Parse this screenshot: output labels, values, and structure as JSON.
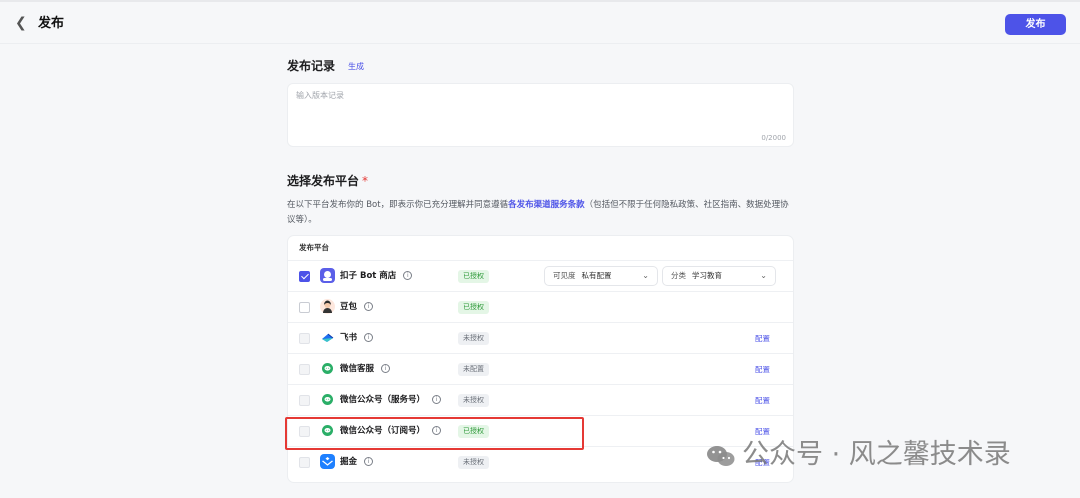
{
  "header": {
    "back_icon": "chevron-left-icon",
    "title": "发布",
    "publish_label": "发布"
  },
  "record": {
    "title": "发布记录",
    "generate_label": "生成",
    "placeholder": "输入版本记录",
    "counter": "0/2000"
  },
  "platform": {
    "title": "选择发布平台",
    "required_mark": "*",
    "desc_before": "在以下平台发布你的 Bot，即表示你已充分理解并同意遵循",
    "desc_link": "各发布渠道服务条款",
    "desc_after": "（包括但不限于任何隐私政策、社区指南、数据处理协议等）。",
    "table_header": "发布平台",
    "rows": [
      {
        "name": "扣子 Bot 商店",
        "status": "已授权",
        "checked": true,
        "visibility_label": "可见度",
        "visibility_value": "私有配置",
        "category_label": "分类",
        "category_value": "学习教育",
        "icon": "coze-store-icon"
      },
      {
        "name": "豆包",
        "status": "已授权",
        "checked": false,
        "icon": "doubao-icon"
      },
      {
        "name": "飞书",
        "status": "未授权",
        "checked": false,
        "config": "配置",
        "icon": "feishu-icon"
      },
      {
        "name": "微信客服",
        "status": "未配置",
        "checked": false,
        "config": "配置",
        "icon": "wechat-icon"
      },
      {
        "name": "微信公众号（服务号）",
        "status": "未授权",
        "checked": false,
        "config": "配置",
        "icon": "wechat-icon"
      },
      {
        "name": "微信公众号（订阅号）",
        "status": "已授权",
        "checked": false,
        "config": "配置",
        "icon": "wechat-icon"
      },
      {
        "name": "掘金",
        "status": "未授权",
        "checked": false,
        "config": "配置",
        "icon": "juejin-icon"
      }
    ]
  },
  "watermark": "公众号 · 风之馨技术录",
  "colors": {
    "accent": "#4d53e8",
    "highlight": "#e53935",
    "wechat": "#2aae67"
  }
}
